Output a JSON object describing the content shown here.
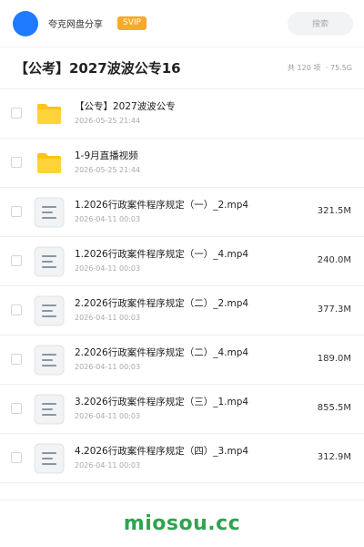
{
  "header": {
    "username": "夸克网盘分享",
    "badge": "SVIP",
    "search_placeholder": "搜索",
    "accent": "#1f7bff",
    "badge_color": "#f7a928"
  },
  "folder": {
    "title": "【公考】2027波波公专16",
    "count": "共 120 项",
    "total_size": "· 75.5G"
  },
  "items": [
    {
      "type": "folder",
      "icon": "folder-icon",
      "name": "【公专】2027波波公专",
      "date": "2026-05-25 21:44",
      "size": ""
    },
    {
      "type": "folder",
      "icon": "folder-icon",
      "name": "1-9月直播视频",
      "date": "2026-05-25 21:44",
      "size": ""
    },
    {
      "type": "file",
      "icon": "video-file-icon",
      "name": "1.2026行政案件程序规定（一）_2.mp4",
      "date": "2026-04-11 00:03",
      "size": "321.5M"
    },
    {
      "type": "file",
      "icon": "video-file-icon",
      "name": "1.2026行政案件程序规定（一）_4.mp4",
      "date": "2026-04-11 00:03",
      "size": "240.0M"
    },
    {
      "type": "file",
      "icon": "video-file-icon",
      "name": "2.2026行政案件程序规定（二）_2.mp4",
      "date": "2026-04-11 00:03",
      "size": "377.3M"
    },
    {
      "type": "file",
      "icon": "video-file-icon",
      "name": "2.2026行政案件程序规定（二）_4.mp4",
      "date": "2026-04-11 00:03",
      "size": "189.0M"
    },
    {
      "type": "file",
      "icon": "video-file-icon",
      "name": "3.2026行政案件程序规定（三）_1.mp4",
      "date": "2026-04-11 00:03",
      "size": "855.5M"
    },
    {
      "type": "file",
      "icon": "video-file-icon",
      "name": "4.2026行政案件程序规定（四）_3.mp4",
      "date": "2026-04-11 00:03",
      "size": "312.9M"
    }
  ],
  "footer": {
    "watermark": "miosou.cc",
    "watermark_color": "#2ea44f"
  }
}
